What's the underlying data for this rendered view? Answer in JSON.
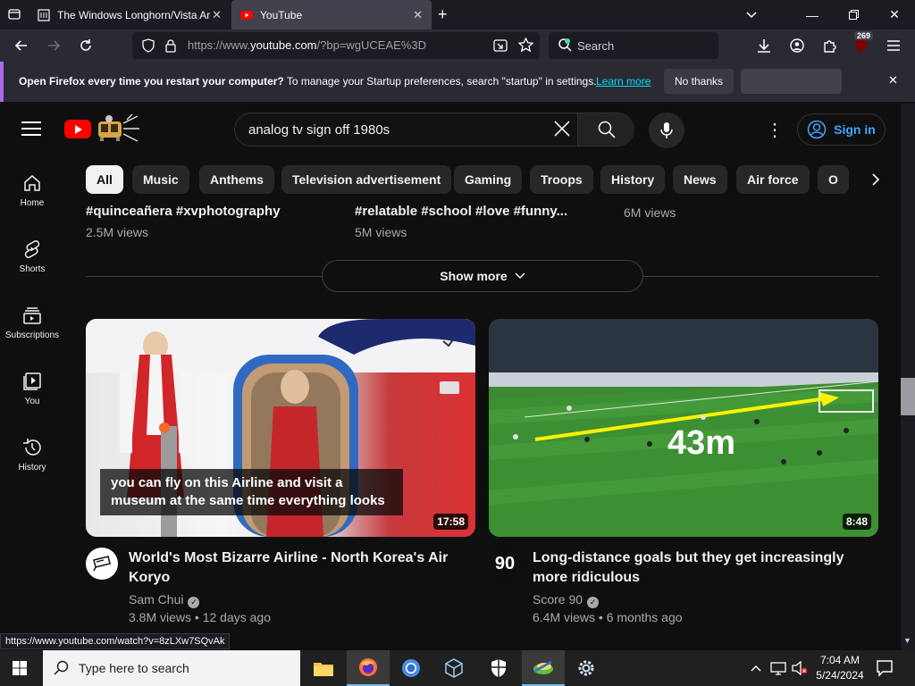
{
  "browser": {
    "tabs": [
      {
        "title": "The Windows Longhorn/Vista Ar",
        "active": false
      },
      {
        "title": "YouTube",
        "active": true
      }
    ],
    "url": {
      "prefix": "https://www.",
      "domain": "youtube.com",
      "rest": "/?bp=wgUCEAE%3D"
    },
    "search_placeholder": "Search",
    "extension_badge": "269"
  },
  "notification": {
    "bold": "Open Firefox every time you restart your computer?",
    "text": " To manage your Startup preferences, search \"startup\" in settings.",
    "link": "Learn more",
    "no_thanks": "No thanks"
  },
  "youtube": {
    "search_query": "analog tv sign off 1980s",
    "sign_in": "Sign in",
    "sidebar": [
      {
        "label": "Home",
        "icon": "home-icon"
      },
      {
        "label": "Shorts",
        "icon": "shorts-icon"
      },
      {
        "label": "Subscriptions",
        "icon": "subscriptions-icon"
      },
      {
        "label": "You",
        "icon": "you-icon"
      },
      {
        "label": "History",
        "icon": "history-icon"
      }
    ],
    "chips": [
      "All",
      "Music",
      "Anthems",
      "Television advertisement",
      "Gaming",
      "Troops",
      "History",
      "News",
      "Air force",
      "O"
    ],
    "shorts_row": [
      {
        "title": "#quinceañera #xvphotography",
        "views": "2.5M views"
      },
      {
        "title": "#relatable #school #love #funny...",
        "views": "5M views"
      },
      {
        "title": "",
        "views": "6M views"
      }
    ],
    "show_more": "Show more",
    "videos": [
      {
        "title": "World's Most Bizarre Airline - North Korea's Air Koryo",
        "channel": "Sam Chui",
        "stats": "3.8M views • 12 days ago",
        "duration": "17:58",
        "caption": "you can fly on this Airline and visit a museum at the same time everything looks"
      },
      {
        "title": "Long-distance goals but they get increasingly more ridiculous",
        "channel": "Score 90",
        "stats": "6.4M views • 6 months ago",
        "duration": "8:48",
        "overlay": "43m",
        "avatar_text": "90"
      }
    ]
  },
  "status_url": "https://www.youtube.com/watch?v=8zLXw7SQvAk",
  "taskbar": {
    "search_placeholder": "Type here to search",
    "time": "7:04 AM",
    "date": "5/24/2024"
  }
}
